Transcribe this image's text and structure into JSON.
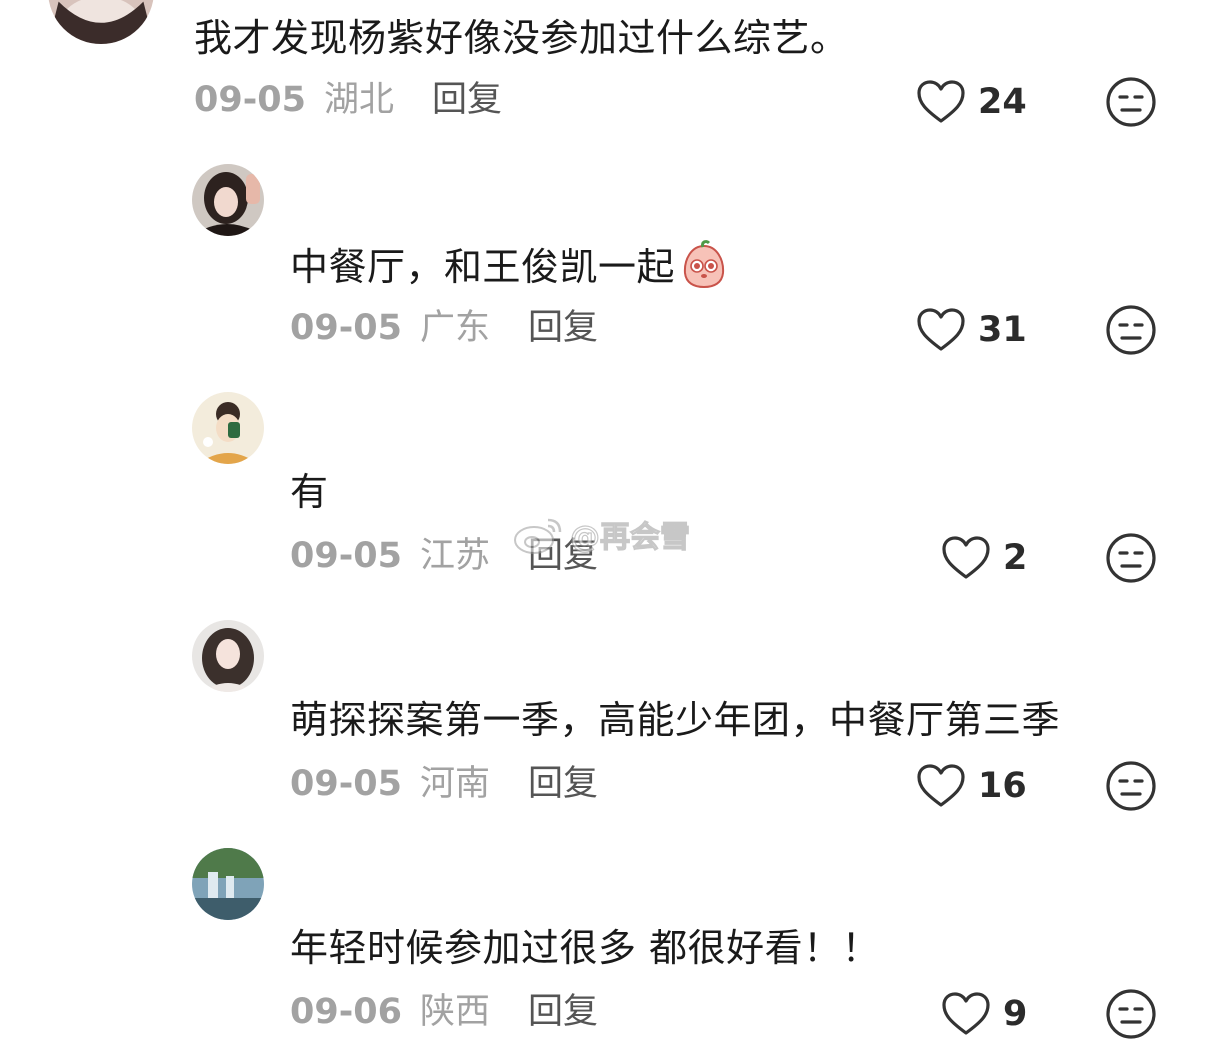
{
  "top_comment": {
    "text": "我才发现杨紫好像没参加过什么综艺。",
    "date": "09-05",
    "region": "湖北",
    "reply_label": "回复",
    "likes": "24"
  },
  "replies": [
    {
      "text": "中餐厅，和王俊凯一起",
      "emoji": "peach-emoji",
      "date": "09-05",
      "region": "广东",
      "reply_label": "回复",
      "likes": "31"
    },
    {
      "text": "有",
      "date": "09-05",
      "region": "江苏",
      "reply_label": "回复",
      "likes": "2"
    },
    {
      "text": "萌探探案第一季，高能少年团，中餐厅第三季",
      "date": "09-05",
      "region": "河南",
      "reply_label": "回复",
      "likes": "16"
    },
    {
      "text": "年轻时候参加过很多 都很好看！！",
      "date": "09-06",
      "region": "陕西",
      "reply_label": "回复",
      "likes": "9"
    }
  ],
  "watermark": {
    "icon": "weibo-icon",
    "text": "@再会雪"
  },
  "icons": {
    "like": "heart-outline-icon",
    "dislike": "meh-face-icon"
  },
  "colors": {
    "text": "#1a1a1a",
    "meta": "#a2a2a2",
    "reply": "#555555",
    "icon": "#333333"
  }
}
